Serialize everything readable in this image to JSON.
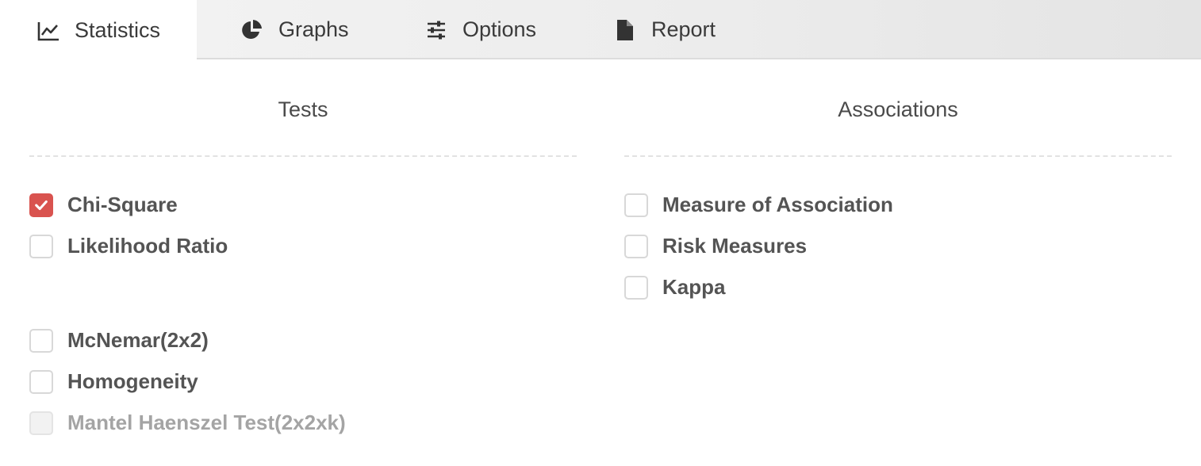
{
  "tabs": [
    {
      "label": "Statistics",
      "icon": "line-chart-icon",
      "active": true
    },
    {
      "label": "Graphs",
      "icon": "pie-chart-icon",
      "active": false
    },
    {
      "label": "Options",
      "icon": "sliders-icon",
      "active": false
    },
    {
      "label": "Report",
      "icon": "file-icon",
      "active": false
    }
  ],
  "tests": {
    "title": "Tests",
    "items": [
      {
        "label": "Chi-Square",
        "checked": true,
        "disabled": false
      },
      {
        "label": "Likelihood Ratio",
        "checked": false,
        "disabled": false
      },
      {
        "label": "McNemar(2x2)",
        "checked": false,
        "disabled": false
      },
      {
        "label": "Homogeneity",
        "checked": false,
        "disabled": false
      },
      {
        "label": "Mantel Haenszel Test(2x2xk)",
        "checked": false,
        "disabled": true
      }
    ]
  },
  "associations": {
    "title": "Associations",
    "items": [
      {
        "label": "Measure of Association",
        "checked": false,
        "disabled": false
      },
      {
        "label": "Risk Measures",
        "checked": false,
        "disabled": false
      },
      {
        "label": "Kappa",
        "checked": false,
        "disabled": false
      }
    ]
  },
  "colors": {
    "accent": "#d9534f",
    "text": "#545454",
    "disabled_text": "#a4a4a4"
  }
}
